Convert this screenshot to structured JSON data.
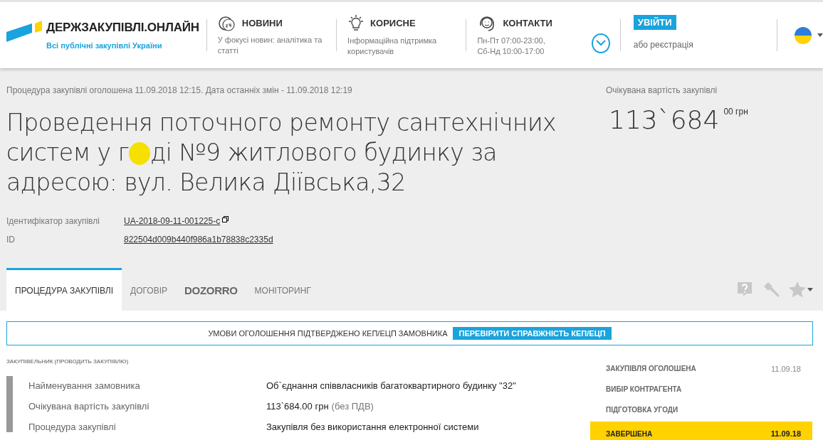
{
  "header": {
    "logo": {
      "name": "ДЕРЖЗАКУПІВЛІ.ОНЛАЙН",
      "tagline": "Всі публічні закупівлі України"
    },
    "nav": [
      {
        "kind": "news",
        "title": "НОВИНИ",
        "text": "У фокусі новин: аналітика та статті"
      },
      {
        "kind": "tips",
        "title": "КОРИСНЕ",
        "text": "Інформаційна підтримка користувачів"
      },
      {
        "kind": "contacts",
        "title": "КОНТАКТИ",
        "text": "Пн-Пт 07:00-23:00,\nСб-Нд 10:00-17:00"
      }
    ],
    "login": {
      "button": "УВІЙТИ",
      "register": "або реєстрація"
    }
  },
  "tender": {
    "announced": "Процедура закупівлі оголошена 11.09.2018 12:15. Дата останніх змін - 11.09.2018 12:19",
    "title_before": "Проведення поточного ремонту сантехнічних систем у г",
    "title_after": "ді №9 житлового будинку за адресою: вул. Велика Діївська,32",
    "value_label": "Очікувана вартість закупівлі",
    "amount": "113`684",
    "amount_suffix": "00 грн",
    "identifiers": [
      {
        "label": "Ідентифікатор закупівлі",
        "value": "UA-2018-09-11-001225-c",
        "copyable": true
      },
      {
        "label": "ID",
        "value": "822504d009b440f986a1b78838c2335d"
      }
    ]
  },
  "tabs": [
    {
      "kind": "text",
      "label": "ПРОЦЕДУРА ЗАКУПІВЛІ",
      "selected": true
    },
    {
      "kind": "text",
      "label": "ДОГОВІР",
      "selected": false
    },
    {
      "kind": "logo",
      "label": "DOZORRO",
      "selected": false
    },
    {
      "kind": "text",
      "label": "МОНІТОРИНГ",
      "selected": false
    }
  ],
  "banner": {
    "text": "УМОВИ ОГОЛОШЕННЯ ПІДТВЕРДЖЕНО КЕП/ЕЦП ЗАМОВНИКА",
    "button": "ПЕРЕВІРИТИ СПРАВЖНІСТЬ КЕП/ЕЦП"
  },
  "customer": {
    "section_title": "ЗАКУПІВЕЛЬНИК (ПРОВОДИТЬ ЗАКУПІВЛЮ)",
    "rows": [
      {
        "label": "Найменування замовника",
        "value": "Об`єднання співвласників багатоквартирного будинку \"32\""
      },
      {
        "label": "Очікувана вартість закупівлі",
        "value": "113`684.00 грн",
        "note": "(без ПДВ)"
      },
      {
        "label": "Процедура закупівлі",
        "value": "Закупівля без використання електронної системи"
      }
    ]
  },
  "statuses": [
    {
      "label": "ЗАКУПІВЛЯ ОГОЛОШЕНА",
      "date": "11.09.18",
      "selected": false
    },
    {
      "label": "ВИБІР КОНТРАГЕНТА",
      "selected": false
    },
    {
      "label": "ПІДГОТОВКА УГОДИ",
      "selected": false
    },
    {
      "label": "ЗАВЕРШЕНА",
      "date": "11.09.18",
      "selected": true
    }
  ]
}
